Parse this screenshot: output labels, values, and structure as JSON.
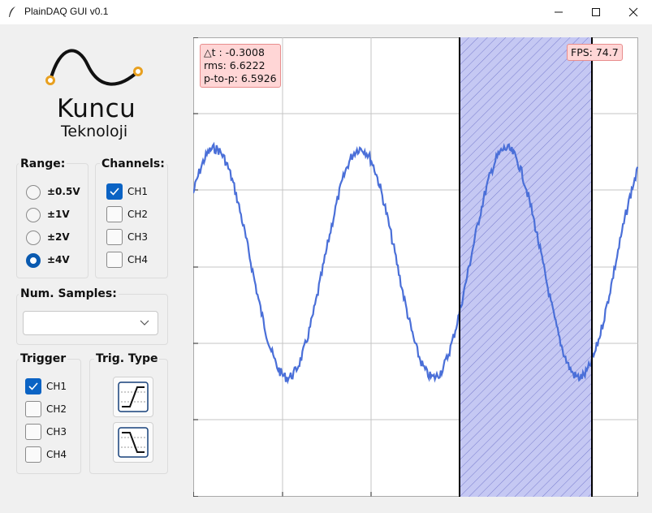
{
  "window": {
    "title": "PlainDAQ GUI v0.1",
    "buttons": [
      "minimize",
      "maximize",
      "close"
    ]
  },
  "logo": {
    "name": "Kuncu",
    "subtitle": "Teknoloji",
    "accent": "#e8a020"
  },
  "range": {
    "label": "Range:",
    "options": [
      "±0.5V",
      "±1V",
      "±2V",
      "±4V"
    ],
    "selected": "±4V"
  },
  "channels": {
    "label": "Channels:",
    "items": [
      {
        "label": "CH1",
        "checked": true
      },
      {
        "label": "CH2",
        "checked": false
      },
      {
        "label": "CH3",
        "checked": false
      },
      {
        "label": "CH4",
        "checked": false
      }
    ]
  },
  "num_samples": {
    "label": "Num. Samples:",
    "value": ""
  },
  "trigger": {
    "label": "Trigger",
    "items": [
      {
        "label": "CH1",
        "checked": true
      },
      {
        "label": "CH2",
        "checked": false
      },
      {
        "label": "CH3",
        "checked": false
      },
      {
        "label": "CH4",
        "checked": false
      }
    ]
  },
  "trig_type": {
    "label": "Trig. Type",
    "options": [
      "rising-edge-icon",
      "falling-edge-icon"
    ]
  },
  "plot": {
    "readout": {
      "dt": "△t : -0.3008",
      "rms": "rms: 6.6222",
      "ptp": "p-to-p: 6.5926"
    },
    "fps": "FPS: 74.7",
    "colors": {
      "trace": "#4a6fd8",
      "selection": "#8a8ee0"
    }
  },
  "chart_data": {
    "type": "line",
    "title": "",
    "xlabel": "",
    "ylabel": "",
    "grid": true,
    "series": [
      {
        "name": "",
        "cycles_visible": 2.5,
        "shape": "noisy sine"
      }
    ],
    "selection_region": "shaded band between two vertical cursors"
  }
}
